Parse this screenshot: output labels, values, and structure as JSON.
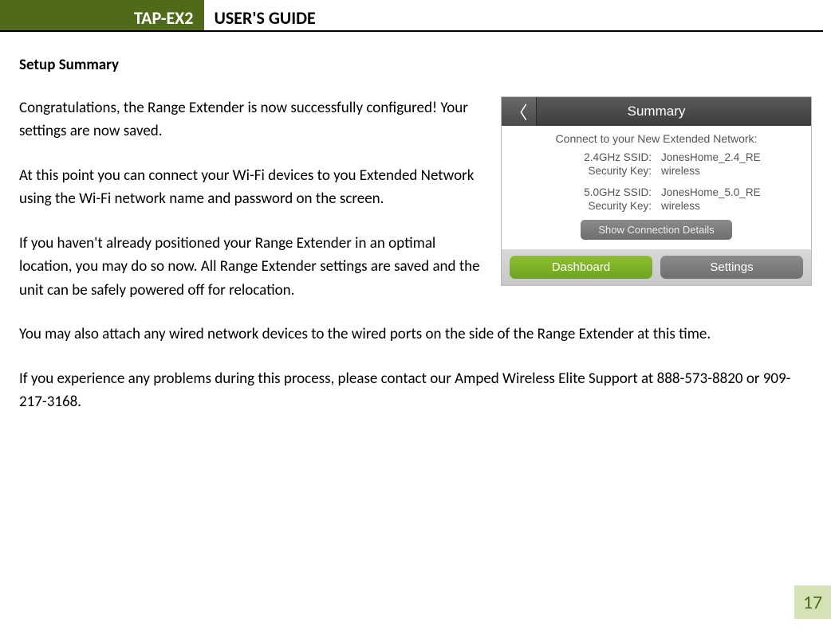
{
  "header": {
    "badge": "TAP-EX2",
    "title": "USER'S GUIDE"
  },
  "section_title": "Setup Summary",
  "paragraphs": {
    "p1": "Congratulations, the Range Extender is now successfully configured! Your settings are now saved.",
    "p2": "At this point you can connect your Wi-Fi devices to you Extended Network using the Wi-Fi network name and password on the screen.",
    "p3": "If you haven't already positioned your Range Extender in an optimal location, you may do so now. All Range Extender settings are saved and the unit can be safely powered off for relocation.",
    "p4": "You may also attach any wired network devices to the wired ports on the side of the Range Extender at this time.",
    "p5": "If you experience any problems during this process, please contact our Amped Wireless Elite Support at 888-573-8820 or 909-217-3168."
  },
  "phone": {
    "back_glyph": "〈",
    "title": "Summary",
    "connect_label": "Connect to your New Extended Network:",
    "rows": {
      "ssid24_label": "2.4GHz SSID:",
      "ssid24_value": "JonesHome_2.4_RE",
      "key24_label": "Security Key:",
      "key24_value": "wireless",
      "ssid50_label": "5.0GHz SSID:",
      "ssid50_value": "JonesHome_5.0_RE",
      "key50_label": "Security Key:",
      "key50_value": "wireless"
    },
    "details_btn": "Show Connection Details",
    "bottom": {
      "dashboard": "Dashboard",
      "settings": "Settings"
    }
  },
  "page_number": "17"
}
